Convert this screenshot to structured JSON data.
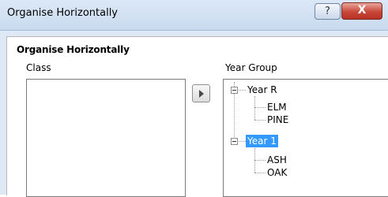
{
  "window": {
    "title": "Organise Horizontally",
    "help_label": "?",
    "close_label": "X"
  },
  "group": {
    "title": "Organise Horizontally"
  },
  "class_panel": {
    "label": "Class",
    "items": []
  },
  "year_panel": {
    "label": "Year Group",
    "tree": [
      {
        "label": "Year  R",
        "expanded": true,
        "selected": false,
        "children": [
          "ELM",
          "PINE"
        ]
      },
      {
        "label": "Year  1",
        "expanded": true,
        "selected": true,
        "children": [
          "ASH",
          "OAK"
        ]
      }
    ]
  },
  "colors": {
    "selection": "#3399ff",
    "titlebar": "#c9daef",
    "close": "#c74838"
  }
}
